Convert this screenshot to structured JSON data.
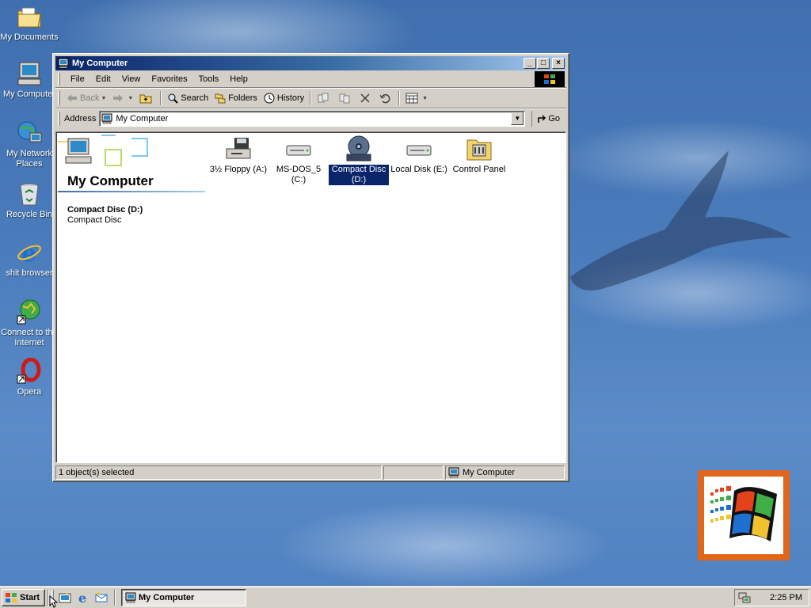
{
  "desktop": {
    "icons": [
      {
        "label": "My Documents",
        "icon": "folder-documents-icon"
      },
      {
        "label": "My Computer",
        "icon": "computer-icon"
      },
      {
        "label": "My Network Places",
        "icon": "network-places-icon"
      },
      {
        "label": "Recycle Bin",
        "icon": "recycle-bin-icon"
      },
      {
        "label": "shit browser",
        "icon": "internet-explorer-icon"
      },
      {
        "label": "Connect to the Internet",
        "icon": "connect-internet-icon"
      },
      {
        "label": "Opera",
        "icon": "opera-icon"
      }
    ]
  },
  "window": {
    "title": "My Computer",
    "controls": {
      "minimize": "_",
      "maximize": "□",
      "close": "×"
    },
    "menu": [
      "File",
      "Edit",
      "View",
      "Favorites",
      "Tools",
      "Help"
    ],
    "toolbar": {
      "back": "Back",
      "search": "Search",
      "folders": "Folders",
      "history": "History"
    },
    "address": {
      "label": "Address",
      "value": "My Computer",
      "go": "Go"
    },
    "side_panel": {
      "heading": "My Computer",
      "selected_name": "Compact Disc (D:)",
      "selected_type": "Compact Disc"
    },
    "items": [
      {
        "label": "3½ Floppy (A:)",
        "icon": "floppy-drive-icon",
        "selected": false
      },
      {
        "label": "MS-DOS_5 (C:)",
        "icon": "hard-disk-icon",
        "selected": false
      },
      {
        "label": "Compact Disc (D:)",
        "icon": "cd-drive-icon",
        "selected": true
      },
      {
        "label": "Local Disk (E:)",
        "icon": "hard-disk-icon",
        "selected": false
      },
      {
        "label": "Control Panel",
        "icon": "control-panel-icon",
        "selected": false
      }
    ],
    "status": {
      "left": "1 object(s) selected",
      "zone": "My Computer"
    }
  },
  "taskbar": {
    "start": "Start",
    "task_title": "My Computer",
    "clock": "2:25 PM"
  },
  "colors": {
    "titlebar_start": "#0a246a",
    "titlebar_end": "#a6caf0",
    "face": "#d4d0c8",
    "selection": "#0a246a",
    "logo_border": "#e0661a"
  }
}
